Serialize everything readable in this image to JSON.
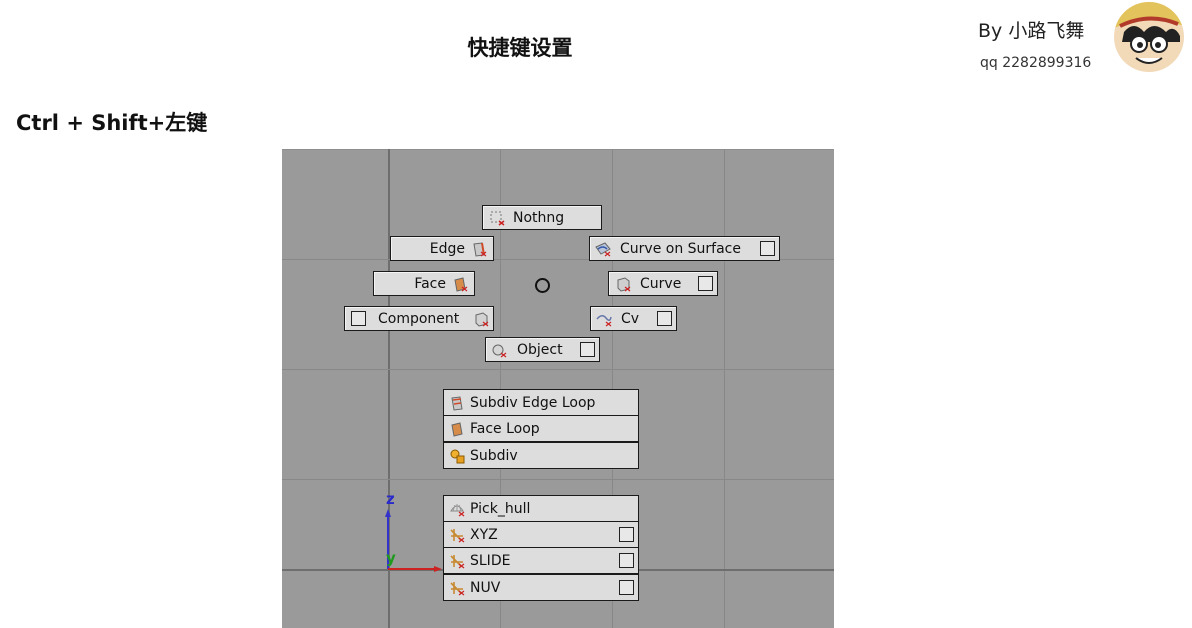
{
  "header": {
    "title": "快捷键设置",
    "author": "By  小路飞舞",
    "qq": "qq  2282899316"
  },
  "shortcut": "Ctrl + Shift+左键",
  "marking_menu": {
    "items": {
      "nothing": "Nothng",
      "edge": "Edge",
      "curve_on_surface": "Curve on Surface",
      "face": "Face",
      "curve": "Curve",
      "component": "Component",
      "cv": "Cv",
      "object": "Object"
    },
    "list1": [
      "Subdiv Edge Loop",
      "Face Loop",
      "Subdiv"
    ],
    "list2": [
      "Pick_hull",
      "XYZ",
      "SLIDE",
      "NUV"
    ]
  },
  "axes": {
    "z": "z",
    "y": "y"
  },
  "colors": {
    "viewport": "#9a9a9a",
    "button": "#dddddd",
    "axis_z": "#3333cc",
    "axis_y": "#22aa22",
    "axis_x": "#cc2222"
  }
}
